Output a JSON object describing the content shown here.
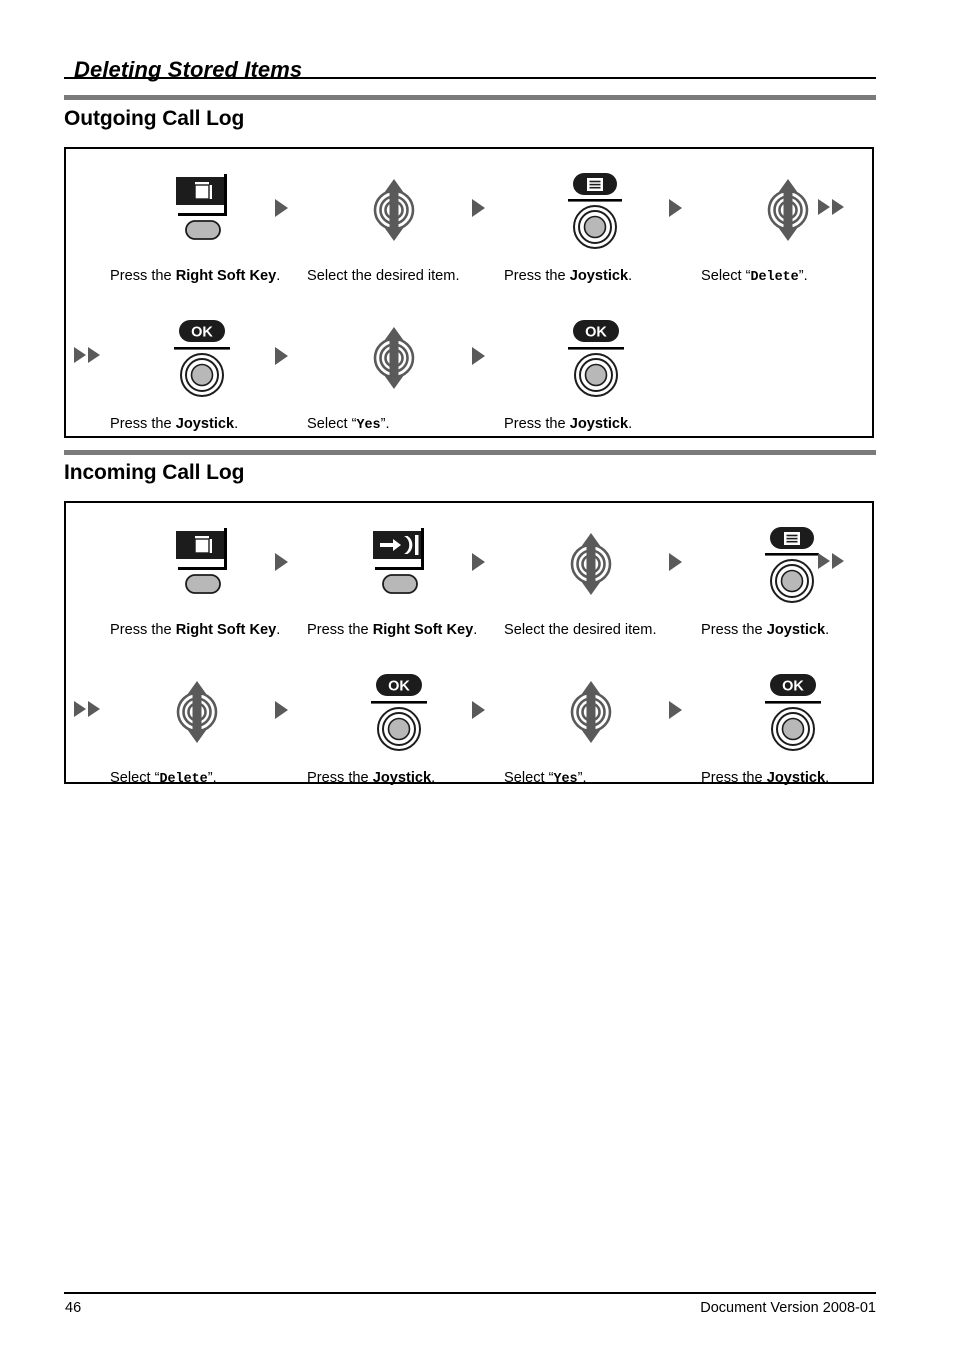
{
  "header": {
    "title": "Deleting Stored Items"
  },
  "footer": {
    "page_number": "46",
    "document_version": "Document Version 2008-01"
  },
  "colors": {
    "rule": "#000000",
    "section_bar": "#7b7b7b",
    "arrow": "#5a5a5a",
    "key_gray": "#b8b8b8",
    "icon_dark": "#1c1c1c"
  },
  "sections": [
    {
      "id": "outgoing-call-log",
      "title": "Outgoing Call Log",
      "rows": [
        {
          "lead_arrow": false,
          "trail_arrow": true,
          "steps": [
            {
              "icon": "right-soft-key-icon",
              "caption_parts": [
                {
                  "t": "Press the ",
                  "s": "plain"
                },
                {
                  "t": "Right Soft Key",
                  "s": "bold"
                },
                {
                  "t": ".",
                  "s": "plain"
                }
              ]
            },
            {
              "icon": "joystick-updown-icon",
              "caption_parts": [
                {
                  "t": "Select the desired item.",
                  "s": "plain"
                }
              ]
            },
            {
              "icon": "menu-joystick-icon",
              "caption_parts": [
                {
                  "t": "Press the ",
                  "s": "plain"
                },
                {
                  "t": "Joystick",
                  "s": "bold"
                },
                {
                  "t": ".",
                  "s": "plain"
                }
              ]
            },
            {
              "icon": "joystick-updown-icon",
              "caption_parts": [
                {
                  "t": "Select “",
                  "s": "plain"
                },
                {
                  "t": "Delete",
                  "s": "mono"
                },
                {
                  "t": "”.",
                  "s": "plain"
                }
              ]
            }
          ]
        },
        {
          "lead_arrow": true,
          "trail_arrow": false,
          "steps": [
            {
              "icon": "ok-joystick-icon",
              "caption_parts": [
                {
                  "t": "Press the ",
                  "s": "plain"
                },
                {
                  "t": "Joystick",
                  "s": "bold"
                },
                {
                  "t": ".",
                  "s": "plain"
                }
              ]
            },
            {
              "icon": "joystick-updown-icon",
              "caption_parts": [
                {
                  "t": "Select “",
                  "s": "plain"
                },
                {
                  "t": "Yes",
                  "s": "mono"
                },
                {
                  "t": "”.",
                  "s": "plain"
                }
              ]
            },
            {
              "icon": "ok-joystick-icon",
              "caption_parts": [
                {
                  "t": "Press the ",
                  "s": "plain"
                },
                {
                  "t": "Joystick",
                  "s": "bold"
                },
                {
                  "t": ".",
                  "s": "plain"
                }
              ]
            }
          ]
        }
      ]
    },
    {
      "id": "incoming-call-log",
      "title": "Incoming Call Log",
      "rows": [
        {
          "lead_arrow": false,
          "trail_arrow": true,
          "steps": [
            {
              "icon": "right-soft-key-icon",
              "caption_parts": [
                {
                  "t": "Press the ",
                  "s": "plain"
                },
                {
                  "t": "Right Soft Key",
                  "s": "bold"
                },
                {
                  "t": ".",
                  "s": "plain"
                }
              ]
            },
            {
              "icon": "incoming-call-soft-key-icon",
              "caption_parts": [
                {
                  "t": "Press the ",
                  "s": "plain"
                },
                {
                  "t": "Right Soft Key",
                  "s": "bold"
                },
                {
                  "t": ".",
                  "s": "plain"
                }
              ]
            },
            {
              "icon": "joystick-updown-icon",
              "caption_parts": [
                {
                  "t": "Select the desired item.",
                  "s": "plain"
                }
              ]
            },
            {
              "icon": "menu-joystick-icon",
              "caption_parts": [
                {
                  "t": "Press the ",
                  "s": "plain"
                },
                {
                  "t": "Joystick",
                  "s": "bold"
                },
                {
                  "t": ".",
                  "s": "plain"
                }
              ]
            }
          ]
        },
        {
          "lead_arrow": true,
          "trail_arrow": false,
          "steps": [
            {
              "icon": "joystick-updown-icon",
              "caption_parts": [
                {
                  "t": "Select “",
                  "s": "plain"
                },
                {
                  "t": "Delete",
                  "s": "mono"
                },
                {
                  "t": "”.",
                  "s": "plain"
                }
              ]
            },
            {
              "icon": "ok-joystick-icon",
              "caption_parts": [
                {
                  "t": "Press the ",
                  "s": "plain"
                },
                {
                  "t": "Joystick",
                  "s": "bold"
                },
                {
                  "t": ".",
                  "s": "plain"
                }
              ]
            },
            {
              "icon": "joystick-updown-icon",
              "caption_parts": [
                {
                  "t": "Select “",
                  "s": "plain"
                },
                {
                  "t": "Yes",
                  "s": "mono"
                },
                {
                  "t": "”.",
                  "s": "plain"
                }
              ]
            },
            {
              "icon": "ok-joystick-icon",
              "caption_parts": [
                {
                  "t": "Press the ",
                  "s": "plain"
                },
                {
                  "t": "Joystick",
                  "s": "bold"
                },
                {
                  "t": ".",
                  "s": "plain"
                }
              ]
            }
          ]
        }
      ]
    }
  ],
  "icon_labels": {
    "ok": "OK"
  }
}
